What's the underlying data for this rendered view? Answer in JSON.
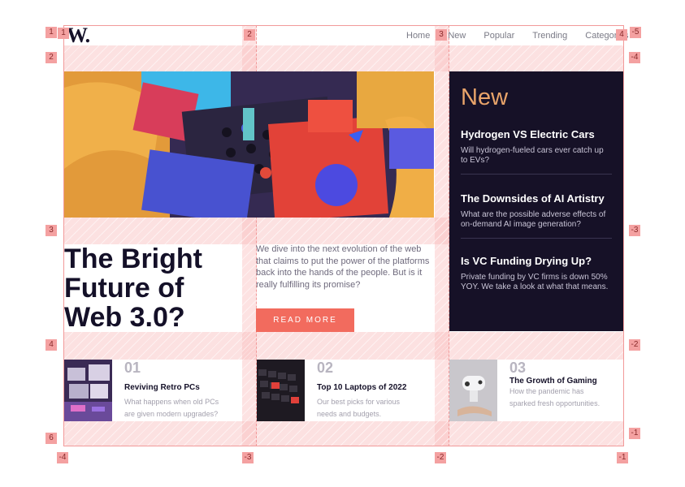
{
  "logo": "W.",
  "nav": [
    "Home",
    "New",
    "Popular",
    "Trending",
    "Categories"
  ],
  "hero": {
    "title": "The Bright Future of Web 3.0?",
    "intro": "We dive into the next evolution of the web that claims to put the power of the platforms back into the hands of the people. But is it really fulfilling its promise?",
    "button": "READ MORE"
  },
  "side": {
    "title": "New",
    "items": [
      {
        "title": "Hydrogen VS Electric Cars",
        "desc": "Will hydrogen-fueled cars ever catch up to EVs?"
      },
      {
        "title": "The Downsides of AI Artistry",
        "desc": "What are the possible adverse effects of on-demand AI image generation?"
      },
      {
        "title": "Is VC Funding Drying Up?",
        "desc": "Private funding by VC firms is down 50% YOY. We take a look at what that means."
      }
    ]
  },
  "articles": [
    {
      "num": "01",
      "title": "Reviving Retro PCs",
      "desc": "What happens when old PCs are given modern upgrades?"
    },
    {
      "num": "02",
      "title": "Top 10 Laptops of 2022",
      "desc": "Our best picks for various needs and budgets."
    },
    {
      "num": "03",
      "title": "The Growth of Gaming",
      "desc": "How the pandemic has sparked fresh opportunities."
    }
  ],
  "grid_labels": {
    "top": [
      "1",
      "2",
      "3",
      "4",
      "-5"
    ],
    "bottom": [
      "-4",
      "-3",
      "-2",
      "-1"
    ],
    "left": [
      "1",
      "2",
      "3",
      "4",
      "6"
    ],
    "right": [
      "-4",
      "-3",
      "-2",
      "-1"
    ]
  },
  "colors": {
    "accent": "#f26b5e",
    "dark": "#161127",
    "gold": "#e9a46a",
    "overlay": "#f29a9a"
  }
}
